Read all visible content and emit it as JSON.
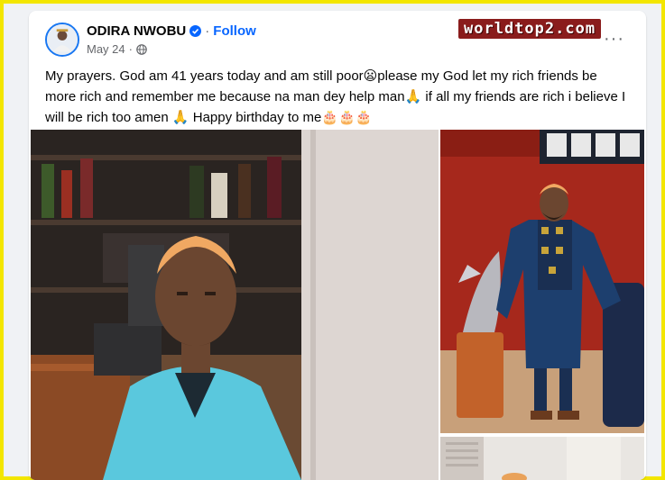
{
  "post": {
    "author": "ODIRA NWOBU",
    "follow_label": "Follow",
    "date": "May 24",
    "separator": "·",
    "more_label": "···",
    "text_part1": "My prayers. God am 41 years today and am still poor",
    "emoji_sad": "😦",
    "text_part2": "please my God let my rich friends be more rich and remember me because na man dey help man",
    "emoji_pray": "🙏",
    "text_part3": " if all my friends are rich i believe I will be rich too amen ",
    "text_part4": " Happy birthday to me",
    "emoji_cakes": "🎂🎂🎂"
  },
  "watermark": "worldtop2.com",
  "icons": {
    "verified": "verified-badge-icon",
    "audience": "globe-icon",
    "more": "more-options-icon"
  },
  "colors": {
    "accent": "#0866ff",
    "frame": "#f3e600",
    "suit_blue": "#5ac8dd"
  }
}
